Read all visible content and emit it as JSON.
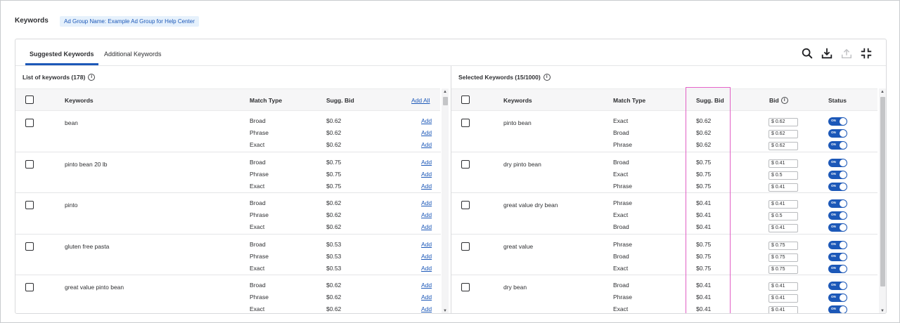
{
  "header": {
    "title": "Keywords",
    "ad_group_chip": "Ad Group Name: Example Ad Group for Help Center"
  },
  "tabs": [
    {
      "label": "Suggested Keywords",
      "active": true
    },
    {
      "label": "Additional Keywords",
      "active": false
    }
  ],
  "toolbar": {
    "icons": [
      "search-icon",
      "download-icon",
      "upload-icon",
      "collapse-icon"
    ]
  },
  "left_pane": {
    "title": "List of keywords (178)",
    "columns": {
      "keywords": "Keywords",
      "match_type": "Match Type",
      "sugg_bid": "Sugg. Bid",
      "add_all": "Add All"
    },
    "add_label": "Add",
    "groups": [
      {
        "keyword": "bean",
        "rows": [
          {
            "match": "Broad",
            "bid": "$0.62"
          },
          {
            "match": "Phrase",
            "bid": "$0.62"
          },
          {
            "match": "Exact",
            "bid": "$0.62"
          }
        ]
      },
      {
        "keyword": "pinto bean 20 lb",
        "rows": [
          {
            "match": "Broad",
            "bid": "$0.75"
          },
          {
            "match": "Phrase",
            "bid": "$0.75"
          },
          {
            "match": "Exact",
            "bid": "$0.75"
          }
        ]
      },
      {
        "keyword": "pinto",
        "rows": [
          {
            "match": "Broad",
            "bid": "$0.62"
          },
          {
            "match": "Phrase",
            "bid": "$0.62"
          },
          {
            "match": "Exact",
            "bid": "$0.62"
          }
        ]
      },
      {
        "keyword": "gluten free pasta",
        "rows": [
          {
            "match": "Broad",
            "bid": "$0.53"
          },
          {
            "match": "Phrase",
            "bid": "$0.53"
          },
          {
            "match": "Exact",
            "bid": "$0.53"
          }
        ]
      },
      {
        "keyword": "great value pinto bean",
        "rows": [
          {
            "match": "Broad",
            "bid": "$0.62"
          },
          {
            "match": "Phrase",
            "bid": "$0.62"
          },
          {
            "match": "Exact",
            "bid": "$0.62"
          }
        ]
      }
    ]
  },
  "right_pane": {
    "title": "Selected Keywords (15/1000)",
    "columns": {
      "keywords": "Keywords",
      "match_type": "Match Type",
      "sugg_bid": "Sugg. Bid",
      "bid": "Bid",
      "status": "Status"
    },
    "toggle_label": "ON",
    "groups": [
      {
        "keyword": "pinto bean",
        "rows": [
          {
            "match": "Exact",
            "sugg": "$0.62",
            "bid": "$ 0.62",
            "on": true
          },
          {
            "match": "Broad",
            "sugg": "$0.62",
            "bid": "$ 0.62",
            "on": true
          },
          {
            "match": "Phrase",
            "sugg": "$0.62",
            "bid": "$ 0.62",
            "on": true
          }
        ]
      },
      {
        "keyword": "dry pinto bean",
        "rows": [
          {
            "match": "Broad",
            "sugg": "$0.75",
            "bid": "$ 0.41",
            "on": true
          },
          {
            "match": "Exact",
            "sugg": "$0.75",
            "bid": "$ 0.5",
            "on": true
          },
          {
            "match": "Phrase",
            "sugg": "$0.75",
            "bid": "$ 0.41",
            "on": true
          }
        ]
      },
      {
        "keyword": "great value dry bean",
        "rows": [
          {
            "match": "Phrase",
            "sugg": "$0.41",
            "bid": "$ 0.41",
            "on": true
          },
          {
            "match": "Exact",
            "sugg": "$0.41",
            "bid": "$ 0.5",
            "on": true
          },
          {
            "match": "Broad",
            "sugg": "$0.41",
            "bid": "$ 0.41",
            "on": true
          }
        ]
      },
      {
        "keyword": "great value",
        "rows": [
          {
            "match": "Phrase",
            "sugg": "$0.75",
            "bid": "$ 0.75",
            "on": true
          },
          {
            "match": "Broad",
            "sugg": "$0.75",
            "bid": "$ 0.75",
            "on": true
          },
          {
            "match": "Exact",
            "sugg": "$0.75",
            "bid": "$ 0.75",
            "on": true
          }
        ]
      },
      {
        "keyword": "dry bean",
        "rows": [
          {
            "match": "Broad",
            "sugg": "$0.41",
            "bid": "$ 0.41",
            "on": true
          },
          {
            "match": "Phrase",
            "sugg": "$0.41",
            "bid": "$ 0.41",
            "on": true
          },
          {
            "match": "Exact",
            "sugg": "$0.41",
            "bid": "$ 0.41",
            "on": true
          }
        ]
      }
    ]
  },
  "colors": {
    "accent": "#1c58b8",
    "highlight": "#e15fc5",
    "chip_bg": "#e6f1fc"
  }
}
